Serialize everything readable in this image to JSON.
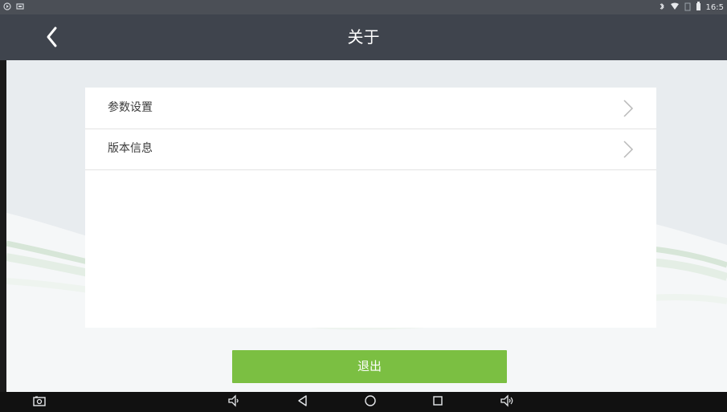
{
  "status_bar": {
    "left_icons": [
      "app-icon",
      "image-icon"
    ],
    "right_icons": [
      "bluetooth-icon",
      "wifi-icon",
      "sim-icon",
      "battery-icon"
    ],
    "time": "16:5"
  },
  "app_bar": {
    "title": "关于",
    "back_icon": "chevron-left-icon"
  },
  "menu": {
    "items": [
      {
        "label": "参数设置",
        "icon": "chevron-right-icon"
      },
      {
        "label": "版本信息",
        "icon": "chevron-right-icon"
      }
    ]
  },
  "actions": {
    "logout_label": "退出"
  },
  "navigation_bar": {
    "icons": [
      "screenshot-icon",
      "volume-down-icon",
      "back-triangle-icon",
      "home-circle-icon",
      "recent-apps-icon",
      "volume-up-icon"
    ]
  },
  "colors": {
    "status_bar": "#4b4f56",
    "app_bar": "#3f444d",
    "content_bg": "#e8ecef",
    "button_green": "#7bbf42",
    "nav_bar": "#111111"
  }
}
